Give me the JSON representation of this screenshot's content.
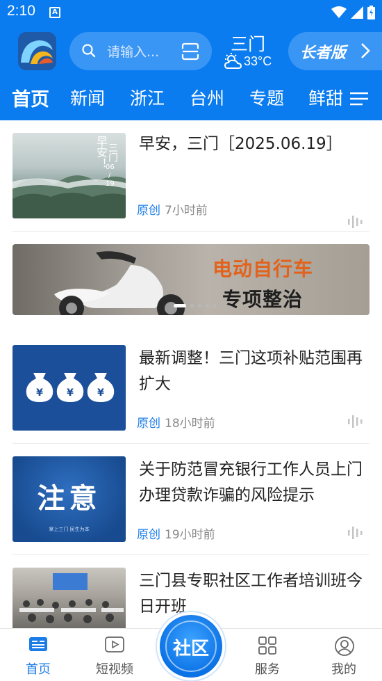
{
  "status_bar": {
    "time": "2:10",
    "sim_badge": "A"
  },
  "header": {
    "search_placeholder": "请输入...",
    "weather": {
      "city": "三门",
      "temperature": "33°C"
    },
    "elder_mode_label": "长者版"
  },
  "tabs": [
    {
      "label": "首页",
      "active": true
    },
    {
      "label": "新闻",
      "active": false
    },
    {
      "label": "浙江",
      "active": false
    },
    {
      "label": "台州",
      "active": false
    },
    {
      "label": "专题",
      "active": false
    },
    {
      "label": "鲜甜",
      "active": false
    }
  ],
  "articles": [
    {
      "title": "早安，三门［2025.06.19］",
      "source": "原创",
      "time_ago": "7小时前",
      "thumb_text": [
        "早安！",
        "三门",
        "06",
        "/",
        "19"
      ]
    },
    {
      "title": "最新调整！三门这项补贴范围再扩大",
      "source": "原创",
      "time_ago": "18小时前"
    },
    {
      "title": "关于防范冒充银行工作人员上门办理贷款诈骗的风险提示",
      "source": "原创",
      "time_ago": "19小时前",
      "thumb_text": [
        "注意",
        "掌上三门 民生为本"
      ]
    },
    {
      "title": "三门县专职社区工作者培训班今日开班"
    }
  ],
  "banner": {
    "line1": "电动自行车",
    "line2": "专项整治",
    "slide_count": 5,
    "active_slide": 1
  },
  "bottom_nav": {
    "home": "首页",
    "short_video": "短视频",
    "community": "社区",
    "services": "服务",
    "mine": "我的",
    "active": "home"
  },
  "colors": {
    "brand_blue": "#0a7cf0",
    "link_blue": "#1a7ce8",
    "meta_gray": "#8a8a8a"
  }
}
